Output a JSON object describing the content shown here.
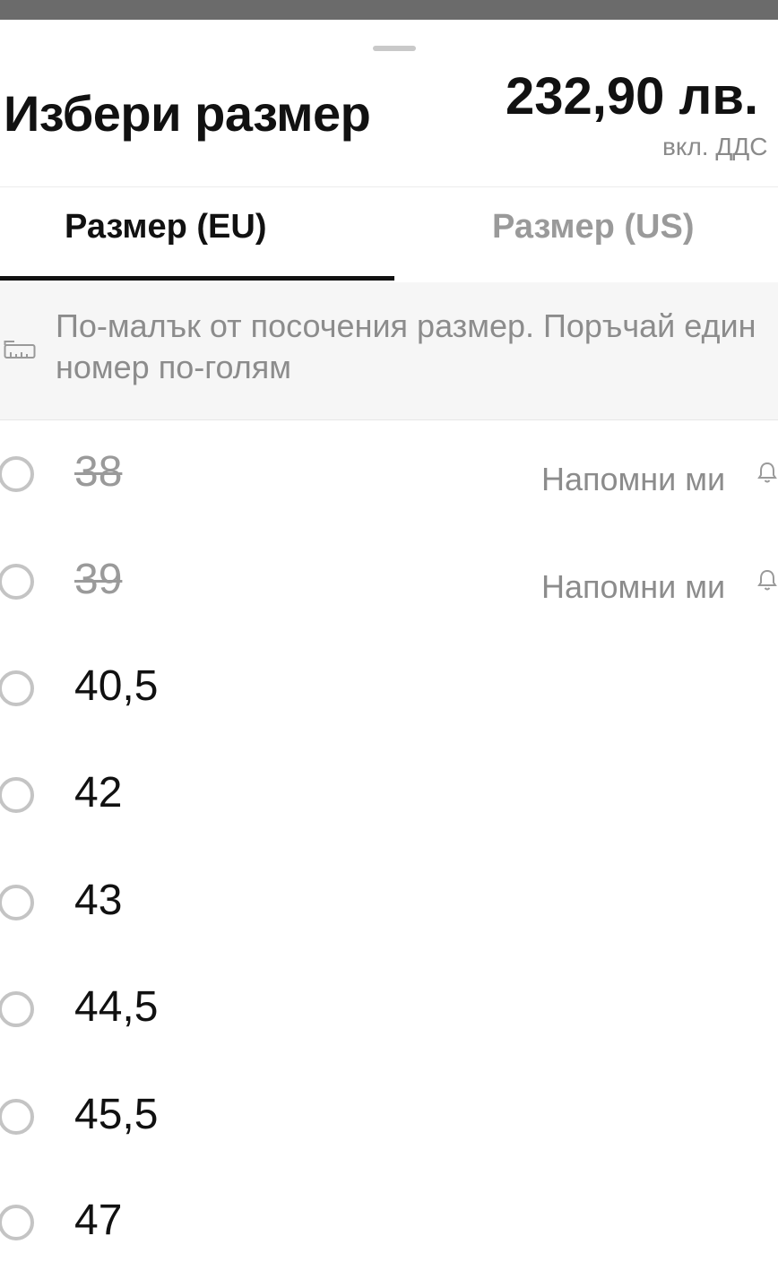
{
  "header": {
    "title": "Избери размер",
    "price": "232,90 лв.",
    "price_note": "вкл. ДДС"
  },
  "tabs": [
    {
      "label": "Размер (EU)",
      "active": true
    },
    {
      "label": "Размер (US)",
      "active": false
    }
  ],
  "notice": {
    "icon": "ruler-icon",
    "text": "По-малък от посочения размер. Поръчай един номер по-голям"
  },
  "sizes": [
    {
      "label": "38",
      "available": false,
      "action": "Напомни ми"
    },
    {
      "label": "39",
      "available": false,
      "action": "Напомни ми"
    },
    {
      "label": "40,5",
      "available": true
    },
    {
      "label": "42",
      "available": true
    },
    {
      "label": "43",
      "available": true
    },
    {
      "label": "44,5",
      "available": true
    },
    {
      "label": "45,5",
      "available": true
    },
    {
      "label": "47",
      "available": true
    }
  ]
}
